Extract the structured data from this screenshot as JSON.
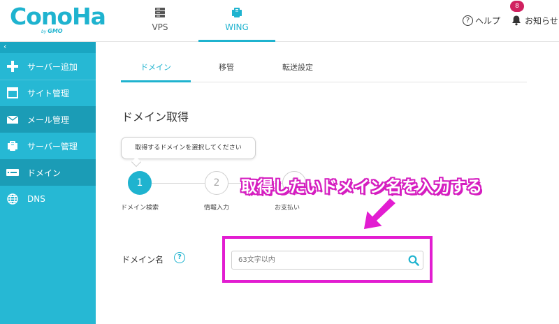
{
  "header": {
    "logo_main": "ConoHa",
    "logo_by": "by",
    "logo_gmo": "GMO",
    "nav": [
      {
        "label": "VPS",
        "icon": "server-stack-icon"
      },
      {
        "label": "WING",
        "icon": "wing-server-icon"
      }
    ],
    "help_label": "ヘルプ",
    "help_icon_glyph": "?",
    "notice_label": "お知らせ",
    "notice_count": "8"
  },
  "sidebar": {
    "collapse_glyph": "‹",
    "items": [
      {
        "label": "サーバー追加",
        "icon": "plus-icon"
      },
      {
        "label": "サイト管理",
        "icon": "window-icon"
      },
      {
        "label": "メール管理",
        "icon": "mail-icon"
      },
      {
        "label": "サーバー管理",
        "icon": "server-icon"
      },
      {
        "label": "ドメイン",
        "icon": "domain-icon"
      },
      {
        "label": "DNS",
        "icon": "globe-icon"
      }
    ]
  },
  "tabs": [
    {
      "label": "ドメイン",
      "active": true
    },
    {
      "label": "移管",
      "active": false
    },
    {
      "label": "転送設定",
      "active": false
    }
  ],
  "page_title": "ドメイン取得",
  "tooltip": "取得するドメインを選択してください",
  "steps": [
    {
      "number": "1",
      "label": "ドメイン検索",
      "active": true
    },
    {
      "number": "2",
      "label": "情報入力",
      "active": false
    },
    {
      "number": "3",
      "label": "お支払い",
      "active": false
    }
  ],
  "annotation": "取得したいドメイン名を入力する",
  "domain_field": {
    "label": "ドメイン名",
    "help_glyph": "?",
    "placeholder": "63文字以内",
    "value": ""
  },
  "colors": {
    "accent": "#1fb3cf",
    "sidebar": "#26b8d4",
    "sidebar_dark": "#1b9cb6",
    "badge": "#d0215f",
    "highlight": "#e21dd1"
  }
}
